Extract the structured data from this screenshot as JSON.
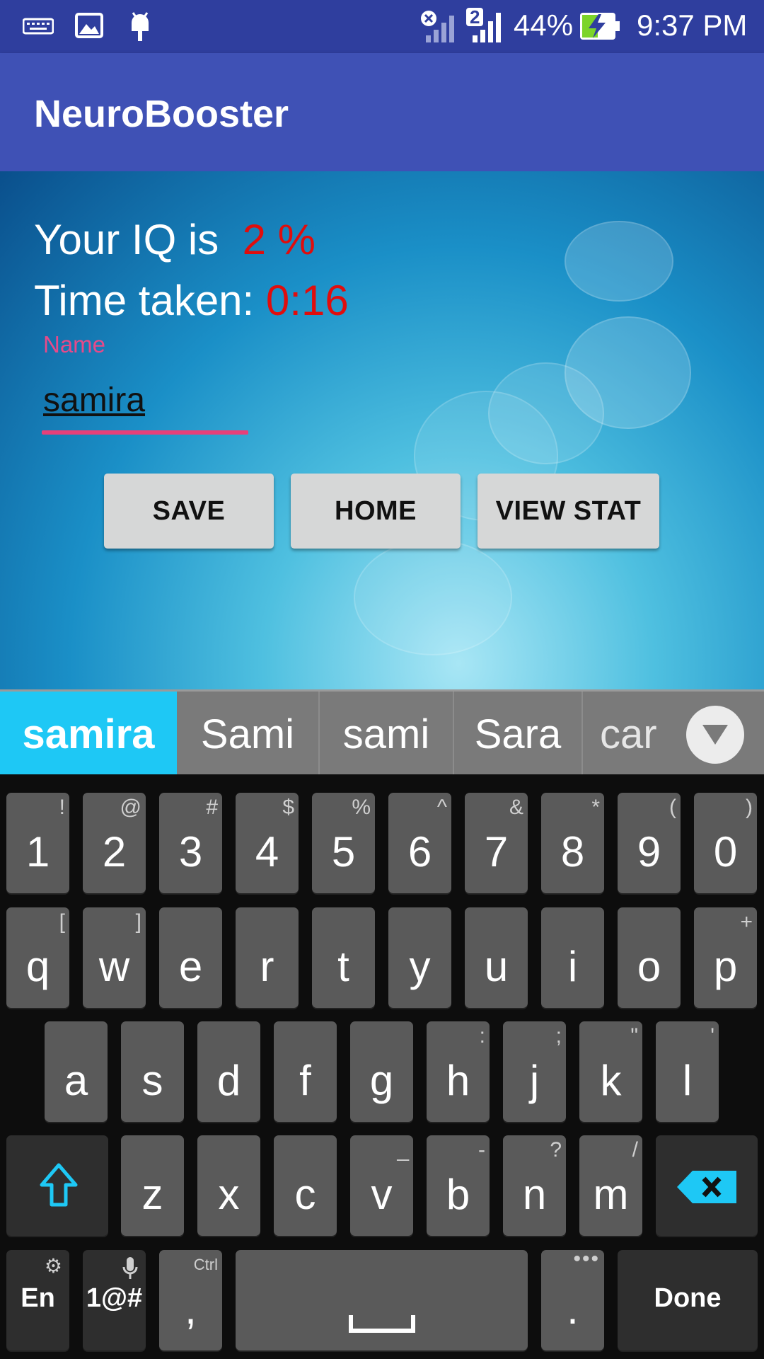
{
  "status_bar": {
    "battery": "44%",
    "time": "9:37 PM",
    "sim_number": "2",
    "icons": [
      "keyboard-icon",
      "image-icon",
      "android-icon",
      "signal-x-icon",
      "signal-icon",
      "battery-charging-icon"
    ]
  },
  "app_bar": {
    "title": "NeuroBooster"
  },
  "result": {
    "iq_label": "Your IQ is",
    "iq_value": "2 %",
    "time_label": "Time taken:",
    "time_value": "0:16"
  },
  "name_field": {
    "label": "Name",
    "value": "samira"
  },
  "buttons": {
    "save": "SAVE",
    "home": "HOME",
    "view_stat": "VIEW STAT"
  },
  "suggestions": [
    "samira",
    "Sami",
    "sami",
    "Sara",
    "car"
  ],
  "keyboard": {
    "number_row": [
      {
        "key": "1",
        "hint": "!"
      },
      {
        "key": "2",
        "hint": "@"
      },
      {
        "key": "3",
        "hint": "#"
      },
      {
        "key": "4",
        "hint": "$"
      },
      {
        "key": "5",
        "hint": "%"
      },
      {
        "key": "6",
        "hint": "^"
      },
      {
        "key": "7",
        "hint": "&"
      },
      {
        "key": "8",
        "hint": "*"
      },
      {
        "key": "9",
        "hint": "("
      },
      {
        "key": "0",
        "hint": ")"
      }
    ],
    "row1": [
      {
        "key": "q",
        "hint": "["
      },
      {
        "key": "w",
        "hint": "]"
      },
      {
        "key": "e",
        "hint": ""
      },
      {
        "key": "r",
        "hint": ""
      },
      {
        "key": "t",
        "hint": ""
      },
      {
        "key": "y",
        "hint": ""
      },
      {
        "key": "u",
        "hint": ""
      },
      {
        "key": "i",
        "hint": ""
      },
      {
        "key": "o",
        "hint": ""
      },
      {
        "key": "p",
        "hint": "+"
      }
    ],
    "row2": [
      {
        "key": "a",
        "hint": ""
      },
      {
        "key": "s",
        "hint": ""
      },
      {
        "key": "d",
        "hint": ""
      },
      {
        "key": "f",
        "hint": ""
      },
      {
        "key": "g",
        "hint": ""
      },
      {
        "key": "h",
        "hint": ":"
      },
      {
        "key": "j",
        "hint": ";"
      },
      {
        "key": "k",
        "hint": "\""
      },
      {
        "key": "l",
        "hint": "'"
      }
    ],
    "row3": [
      {
        "key": "z",
        "hint": ""
      },
      {
        "key": "x",
        "hint": ""
      },
      {
        "key": "c",
        "hint": ""
      },
      {
        "key": "v",
        "hint": "_"
      },
      {
        "key": "b",
        "hint": "-"
      },
      {
        "key": "n",
        "hint": "?"
      },
      {
        "key": "m",
        "hint": "/"
      }
    ],
    "lang": "En",
    "symbols": "1@#",
    "comma": ",",
    "comma_hint": "Ctrl",
    "period": ".",
    "done": "Done"
  },
  "colors": {
    "primary": "#3f51b5",
    "primary_dark": "#2f3e9e",
    "accent": "#e6407a",
    "highlight": "#1ec8f5",
    "result_red": "#e00d0d"
  }
}
